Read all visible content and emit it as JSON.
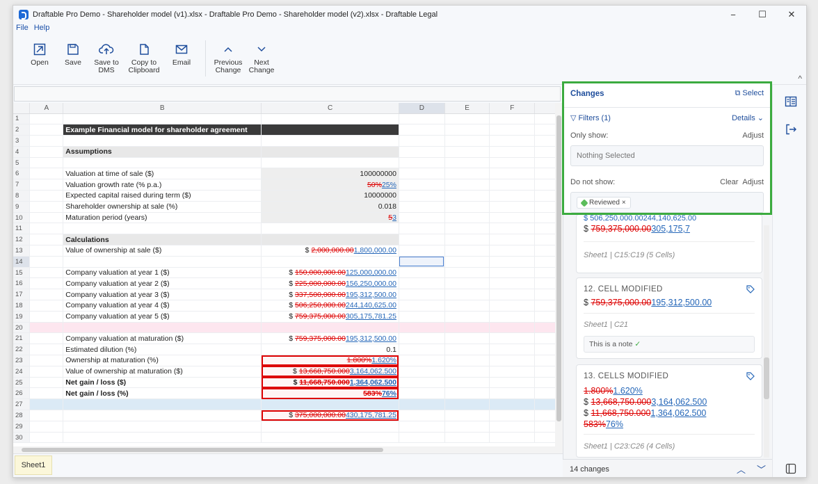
{
  "window": {
    "title": "Draftable Pro Demo - Shareholder model (v1).xlsx - Draftable Pro Demo - Shareholder model (v2).xlsx - Draftable Legal",
    "minimize": "−",
    "maximize": "☐",
    "close": "✕"
  },
  "menu": {
    "file": "File",
    "help": "Help"
  },
  "toolbar": {
    "open": "Open",
    "save": "Save",
    "save_dms": "Save to\nDMS",
    "copy": "Copy to\nClipboard",
    "email": "Email",
    "prev": "Previous\nChange",
    "next": "Next\nChange",
    "collapse": "^"
  },
  "sheet": {
    "columns": [
      "A",
      "B",
      "C",
      "D",
      "E",
      "F"
    ],
    "tab": "Sheet1",
    "rows": {
      "r2_b": "Example Financial model for shareholder agreement",
      "r4_b": "Assumptions",
      "r6_b": "Valuation at time of sale ($)",
      "r6_c": "100000000",
      "r7_b": "Valuation growth rate (% p.a.)",
      "r7_del": "50%",
      "r7_ins": "25%",
      "r8_b": "Expected capital raised during term ($)",
      "r8_c": "10000000",
      "r9_b": "Shareholder ownership at sale (%)",
      "r9_c": "0.018",
      "r10_b": "Maturation period (years)",
      "r10_del": "5",
      "r10_ins": "3",
      "r12_b": "Calculations",
      "r13_b": "Value of ownership at sale ($)",
      "r13_pre": "$ ",
      "r13_del": "2,000,000.00",
      "r13_ins": "1,800,000.00",
      "r15_b": "Company valuation at year 1 ($)",
      "r15_del": "150,000,000.00",
      "r15_ins": "125,000,000.00",
      "r16_b": "Company valuation at year 2 ($)",
      "r16_del": "225,000,000.00",
      "r16_ins": "156,250,000.00",
      "r17_b": "Company valuation at year 3 ($)",
      "r17_del": "337,500,000.00",
      "r17_ins": "195,312,500.00",
      "r18_b": "Company valuation at year 4 ($)",
      "r18_del": "506,250,000.00",
      "r18_ins": "244,140,625.00",
      "r19_b": "Company valuation at year 5 ($)",
      "r19_del": "759,375,000.00",
      "r19_ins": "305,175,781.25",
      "r21_b": "Company valuation at maturation ($)",
      "r21_del": "759,375,000.00",
      "r21_ins": "195,312,500.00",
      "r22_b": "Estimated dilution (%)",
      "r22_c": "0.1",
      "r23_b": "Ownership at maturation (%)",
      "r23_del": "1.800%",
      "r23_ins": "1.620%",
      "r24_b": "Value of ownership at maturation ($)",
      "r24_del": "13,668,750.000",
      "r24_ins": "3,164,062.500",
      "r25_b": "Net gain / loss ($)",
      "r25_del": "11,668,750.000",
      "r25_ins": "1,364,062.500",
      "r26_b": "Net gain / loss (%)",
      "r26_del": "583%",
      "r26_ins": "76%",
      "r28_del": "375,000,000.00",
      "r28_ins": "430,175,781.25"
    }
  },
  "changes_panel": {
    "title": "Changes",
    "select": "Select",
    "filters": "Filters (1)",
    "details": "Details",
    "only_show": "Only show:",
    "adjust": "Adjust",
    "nothing_selected": "Nothing Selected",
    "do_not_show": "Do not show:",
    "clear": "Clear",
    "chip": "Reviewed",
    "card11_line1": "$ 506,250,000.00244,140,625.00",
    "card11_del": "759,375,000.00",
    "card11_ins": "305,175,7",
    "card11_meta": "Sheet1 | C15:C19 (5 Cells)",
    "card12_title": "12. CELL MODIFIED",
    "card12_del": "759,375,000.00",
    "card12_ins": "195,312,500.00",
    "card12_meta": "Sheet1 | C21",
    "card12_note": "This is a note",
    "card13_title": "13. CELLS MODIFIED",
    "card13_l1_del": "1.800%",
    "card13_l1_ins": "1.620%",
    "card13_l2_del": "13,668,750.000",
    "card13_l2_ins": "3,164,062.500",
    "card13_l3_del": "11,668,750.000",
    "card13_l3_ins": "1,364,062.500",
    "card13_l4_del": "583%",
    "card13_l4_ins": "76%",
    "card13_meta": "Sheet1 | C23:C26 (4 Cells)",
    "footer": "14 changes"
  },
  "colors": {
    "accent": "#1f4e9c",
    "highlight_green": "#3bab3f",
    "deleted": "#d00000",
    "inserted": "#2466b8"
  },
  "icons": [
    "open-icon",
    "save-icon",
    "upload-cloud-icon",
    "copy-icon",
    "email-icon",
    "chevron-up-icon",
    "chevron-down-icon",
    "filter-icon",
    "tag-icon",
    "changes-panel-icon",
    "exit-icon",
    "panel-toggle-icon"
  ]
}
